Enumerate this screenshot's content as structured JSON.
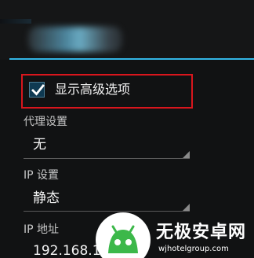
{
  "dialog": {
    "title": ""
  },
  "advanced_option": {
    "label": "显示高级选项",
    "checked": true,
    "icon": "checkmark-icon"
  },
  "proxy": {
    "label": "代理设置",
    "value": "无"
  },
  "ip_settings": {
    "label": "IP 设置",
    "value": "静态"
  },
  "ip_address": {
    "label": "IP 地址",
    "value": "192.168.1."
  },
  "watermark": {
    "name": "无极安卓网",
    "url": "wjhotelgroup.com",
    "icon": "android-logo-icon"
  },
  "colors": {
    "accent": "#33b5e5",
    "highlight": "#d9161d",
    "background": "#101112",
    "watermark_green": "#3cb84a"
  }
}
